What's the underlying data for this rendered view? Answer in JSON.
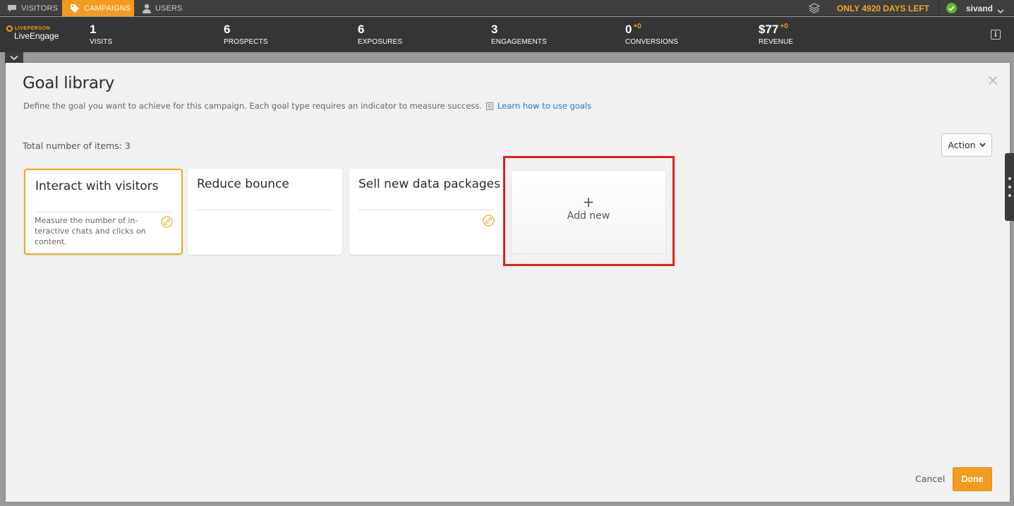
{
  "topnav": {
    "tabs": [
      {
        "label": "VISITORS",
        "icon": "chat-bubble-icon",
        "active": false
      },
      {
        "label": "CAMPAIGNS",
        "icon": "tag-icon",
        "active": true
      },
      {
        "label": "USERS",
        "icon": "user-icon",
        "active": false
      }
    ],
    "trial_text": "ONLY 4920 DAYS LEFT",
    "username": "sivand",
    "accent_color": "#f39a1f",
    "status_color": "#5cb82e"
  },
  "brand": {
    "small": "LIVEPERSON",
    "name": "LiveEngage"
  },
  "stats": [
    {
      "value": "1",
      "delta": "",
      "label": "VISITS"
    },
    {
      "value": "6",
      "delta": "",
      "label": "PROSPECTS"
    },
    {
      "value": "6",
      "delta": "",
      "label": "EXPOSURES"
    },
    {
      "value": "3",
      "delta": "",
      "label": "ENGAGEMENTS"
    },
    {
      "value": "0",
      "delta": "+0",
      "label": "CONVERSIONS"
    },
    {
      "value": "$77",
      "delta": "+0",
      "label": "REVENUE"
    }
  ],
  "modal": {
    "title": "Goal library",
    "description": "Define the goal you want to achieve for this campaign. Each goal type requires an indicator to measure success.",
    "learn_link": "Learn how to use goals",
    "total_items": "Total number of items: 3",
    "action_label": "Action",
    "cards": [
      {
        "title": "Interact with visitors",
        "description": "Measure the number of in-teractive chats and clicks on content.",
        "selected": true,
        "has_link_icon": true
      },
      {
        "title": "Reduce bounce",
        "description": "",
        "selected": false,
        "has_link_icon": false
      },
      {
        "title": "Sell new data packages",
        "description": "",
        "selected": false,
        "has_link_icon": true
      }
    ],
    "add_new": {
      "plus": "+",
      "label": "Add new"
    },
    "cancel_label": "Cancel",
    "done_label": "Done"
  }
}
